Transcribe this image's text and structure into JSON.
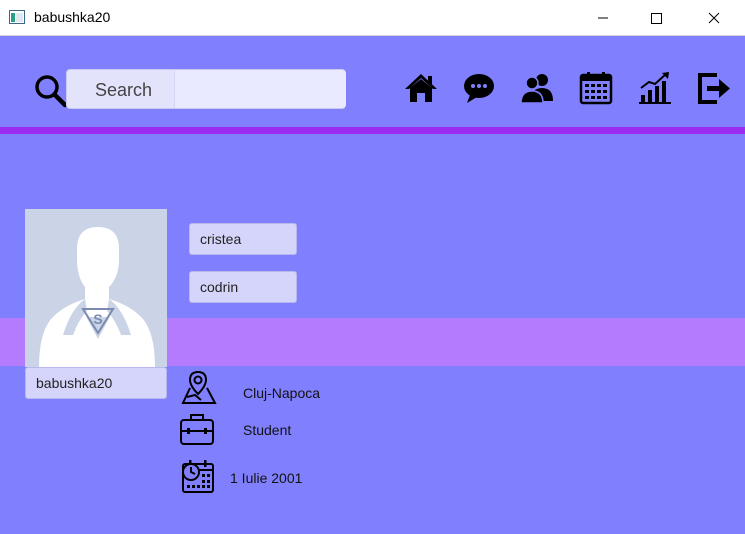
{
  "window": {
    "title": "babushka20"
  },
  "search": {
    "label": "Search",
    "value": ""
  },
  "nav": {
    "items": [
      "home-icon",
      "chat-icon",
      "friends-icon",
      "calendar-icon",
      "stats-icon",
      "logout-icon"
    ]
  },
  "profile": {
    "last_name": "cristea",
    "first_name": "codrin",
    "username": "babushka20",
    "location": "Cluj-Napoca",
    "occupation": "Student",
    "birthdate": "1 Iulie 2001"
  },
  "colors": {
    "background": "#8080ff",
    "accent_line": "#9d2cf2",
    "band": "#b57bff",
    "field": "#d5d5fb"
  }
}
